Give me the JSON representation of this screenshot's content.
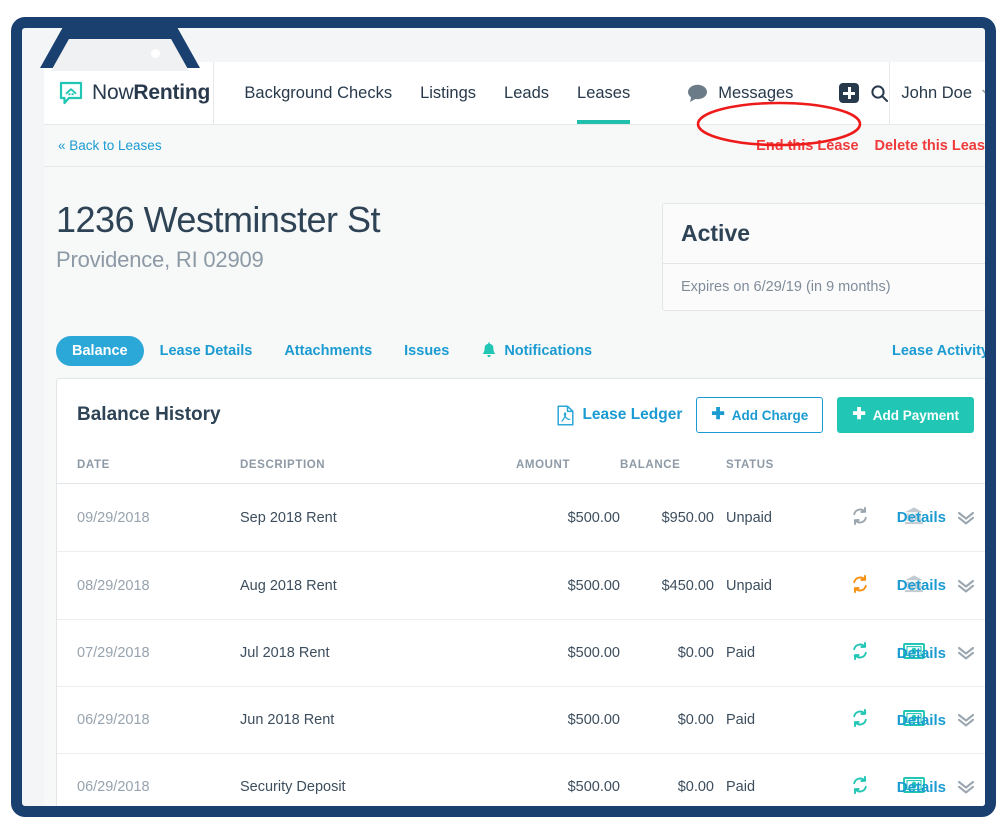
{
  "browser": {
    "tab_dot": "•"
  },
  "header": {
    "brand": {
      "name_light": "Now",
      "name_bold": "Renting",
      "logo_icon": "house-chat-logo-icon"
    },
    "nav": [
      {
        "label": "Background Checks",
        "active": false
      },
      {
        "label": "Listings",
        "active": false
      },
      {
        "label": "Leads",
        "active": false
      },
      {
        "label": "Leases",
        "active": true
      }
    ],
    "messages_label": "Messages",
    "messages_icon": "speech-bubble-icon",
    "add_icon": "plus-box-icon",
    "search_icon": "search-icon",
    "user_name": "John Doe",
    "user_caret_icon": "chevron-down-icon"
  },
  "actionbar": {
    "back_label": "« Back to Leases",
    "end_lease_label": "End this Lease",
    "delete_lease_label": "Delete this Lease",
    "annotation_color": "#ee1b1b"
  },
  "property": {
    "address": "1236 Westminster St",
    "city_state_zip": "Providence, RI 02909"
  },
  "status_card": {
    "status": "Active",
    "expiry": "Expires on 6/29/19 (in 9 months)"
  },
  "tabs": {
    "items": [
      {
        "label": "Balance",
        "active": true,
        "icon": null
      },
      {
        "label": "Lease Details",
        "active": false,
        "icon": null
      },
      {
        "label": "Attachments",
        "active": false,
        "icon": null
      },
      {
        "label": "Issues",
        "active": false,
        "icon": null
      },
      {
        "label": "Notifications",
        "active": false,
        "icon": "bell-icon"
      }
    ],
    "activity_label": "Lease Activity"
  },
  "balance_card": {
    "title": "Balance History",
    "ledger_label": "Lease Ledger",
    "ledger_icon": "pdf-file-icon",
    "add_charge_label": "Add Charge",
    "add_payment_label": "Add Payment",
    "plus_glyph": "✚"
  },
  "table": {
    "columns": [
      "DATE",
      "DESCRIPTION",
      "AMOUNT",
      "BALANCE",
      "STATUS",
      "",
      "",
      ""
    ],
    "details_label": "Details",
    "chevron_icon": "double-chevron-down-icon",
    "rows": [
      {
        "date": "09/29/2018",
        "description": "Sep 2018 Rent",
        "amount": "$500.00",
        "balance": "$950.00",
        "status": "Unpaid",
        "recurring_icon": "refresh-icon",
        "recurring_color": "#9aa6b0",
        "method_icon": "bank-icon",
        "method_color": "#c3cbd2"
      },
      {
        "date": "08/29/2018",
        "description": "Aug 2018 Rent",
        "amount": "$500.00",
        "balance": "$450.00",
        "status": "Unpaid",
        "recurring_icon": "refresh-icon",
        "recurring_color": "#f59010",
        "method_icon": "bank-icon",
        "method_color": "#c3cbd2"
      },
      {
        "date": "07/29/2018",
        "description": "Jul 2018 Rent",
        "amount": "$500.00",
        "balance": "$0.00",
        "status": "Paid",
        "recurring_icon": "refresh-icon",
        "recurring_color": "#21c6b4",
        "method_icon": "cash-icon",
        "method_color": "#21c6b4"
      },
      {
        "date": "06/29/2018",
        "description": "Jun 2018 Rent",
        "amount": "$500.00",
        "balance": "$0.00",
        "status": "Paid",
        "recurring_icon": "refresh-icon",
        "recurring_color": "#21c6b4",
        "method_icon": "cash-icon",
        "method_color": "#21c6b4"
      },
      {
        "date": "06/29/2018",
        "description": "Security Deposit",
        "amount": "$500.00",
        "balance": "$0.00",
        "status": "Paid",
        "recurring_icon": "refresh-icon",
        "recurring_color": "#21c6b4",
        "method_icon": "cash-icon",
        "method_color": "#21c6b4"
      }
    ]
  },
  "colors": {
    "brand_teal": "#21c6b4",
    "link_blue": "#1b9bd1",
    "pill_blue": "#2ba7d8",
    "danger_red": "#ef3b3b",
    "frame_navy": "#19406f",
    "dark_text": "#2e4355"
  }
}
